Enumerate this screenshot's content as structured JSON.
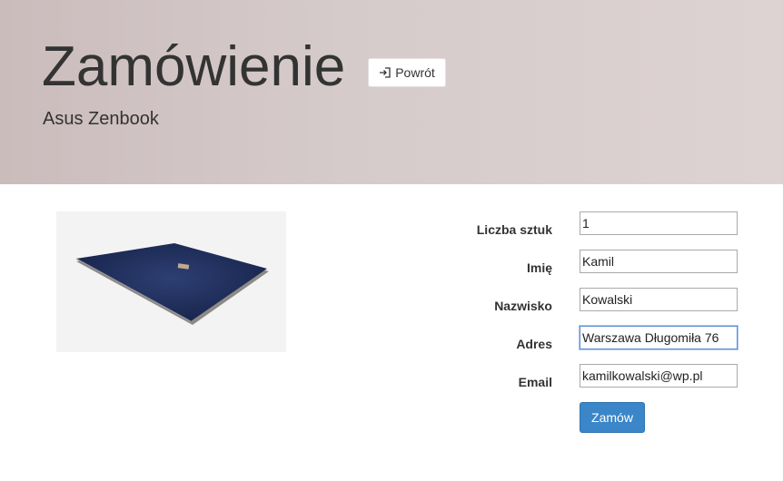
{
  "header": {
    "title": "Zamówienie",
    "back_label": "Powrót",
    "subtitle": "Asus Zenbook"
  },
  "colors": {
    "accent": "#3a86c8",
    "header_bg": "#d6cbcb"
  },
  "form": {
    "quantity": {
      "label": "Liczba sztuk",
      "value": "1"
    },
    "first_name": {
      "label": "Imię",
      "value": "Kamil"
    },
    "last_name": {
      "label": "Nazwisko",
      "value": "Kowalski"
    },
    "address": {
      "label": "Adres",
      "value": "Warszawa Długomiła 76"
    },
    "email": {
      "label": "Email",
      "value": "kamilkowalski@wp.pl"
    },
    "submit_label": "Zamów"
  }
}
